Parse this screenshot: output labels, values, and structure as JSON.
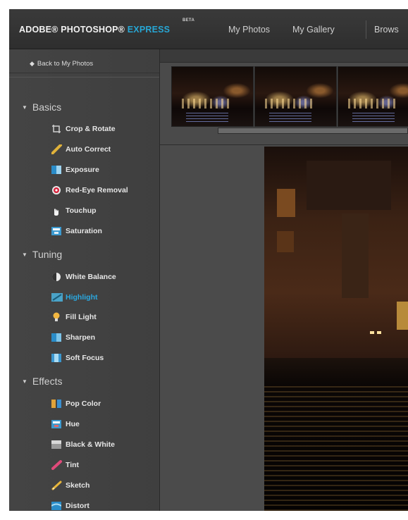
{
  "header": {
    "brand_main": "ADOBE® PHOTOSHOP® ",
    "brand_express": "EXPRESS",
    "brand_beta": "BETA",
    "nav": [
      "My Photos",
      "My Gallery",
      "Brows"
    ]
  },
  "sidebar": {
    "back_label": "Back to My Photos",
    "sections": [
      {
        "title": "Basics",
        "tools": [
          {
            "label": "Crop & Rotate",
            "icon": "crop-icon"
          },
          {
            "label": "Auto Correct",
            "icon": "wand-icon"
          },
          {
            "label": "Exposure",
            "icon": "exposure-icon"
          },
          {
            "label": "Red-Eye Removal",
            "icon": "red-eye-icon"
          },
          {
            "label": "Touchup",
            "icon": "hand-icon"
          },
          {
            "label": "Saturation",
            "icon": "saturation-icon"
          }
        ]
      },
      {
        "title": "Tuning",
        "tools": [
          {
            "label": "White Balance",
            "icon": "white-balance-icon"
          },
          {
            "label": "Highlight",
            "icon": "highlight-icon",
            "active": true
          },
          {
            "label": "Fill Light",
            "icon": "bulb-icon"
          },
          {
            "label": "Sharpen",
            "icon": "sharpen-icon"
          },
          {
            "label": "Soft Focus",
            "icon": "soft-focus-icon"
          }
        ]
      },
      {
        "title": "Effects",
        "tools": [
          {
            "label": "Pop Color",
            "icon": "pop-color-icon"
          },
          {
            "label": "Hue",
            "icon": "hue-icon"
          },
          {
            "label": "Black & White",
            "icon": "black-white-icon"
          },
          {
            "label": "Tint",
            "icon": "tint-icon"
          },
          {
            "label": "Sketch",
            "icon": "sketch-icon"
          },
          {
            "label": "Distort",
            "icon": "distort-icon"
          }
        ]
      }
    ]
  },
  "colors": {
    "accent": "#27a6d4",
    "panel": "#444444",
    "header": "#333333"
  }
}
